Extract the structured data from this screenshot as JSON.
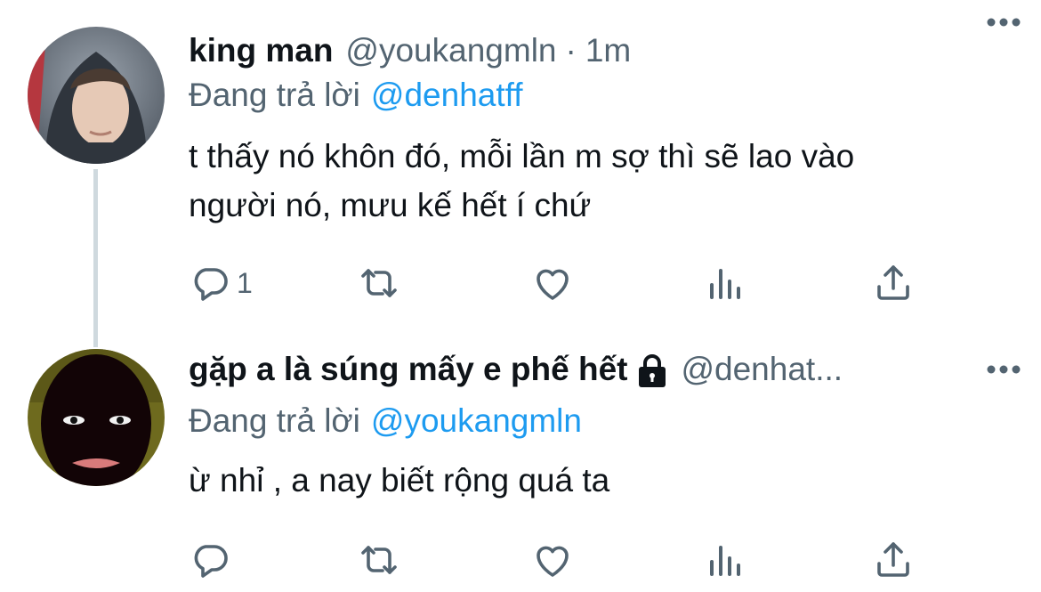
{
  "tweets": [
    {
      "name": "king man",
      "handle": "@youkangmln",
      "separator": "·",
      "time": "1m",
      "replying_label": "Đang trả lời",
      "replying_to": "@denhatff",
      "text_line1": "t thấy nó khôn đó, mỗi lần m sợ thì sẽ lao vào",
      "text_line2": "người nó, mưu kế hết í chứ",
      "reply_count": "1"
    },
    {
      "name": "gặp a là súng mấy e phế hết",
      "handle": "@denhat...",
      "replying_label": "Đang trả lời",
      "replying_to": "@youkangmln",
      "text_line1": "ừ nhỉ , a nay biết rộng quá ta",
      "reply_count": ""
    }
  ],
  "colors": {
    "text": "#0f1419",
    "secondary": "#536471",
    "link": "#1d9bf0",
    "thread_line": "#cfd9de"
  },
  "icons": [
    "more-icon",
    "lock-icon",
    "reply-icon",
    "retweet-icon",
    "like-icon",
    "stats-icon",
    "share-icon"
  ]
}
